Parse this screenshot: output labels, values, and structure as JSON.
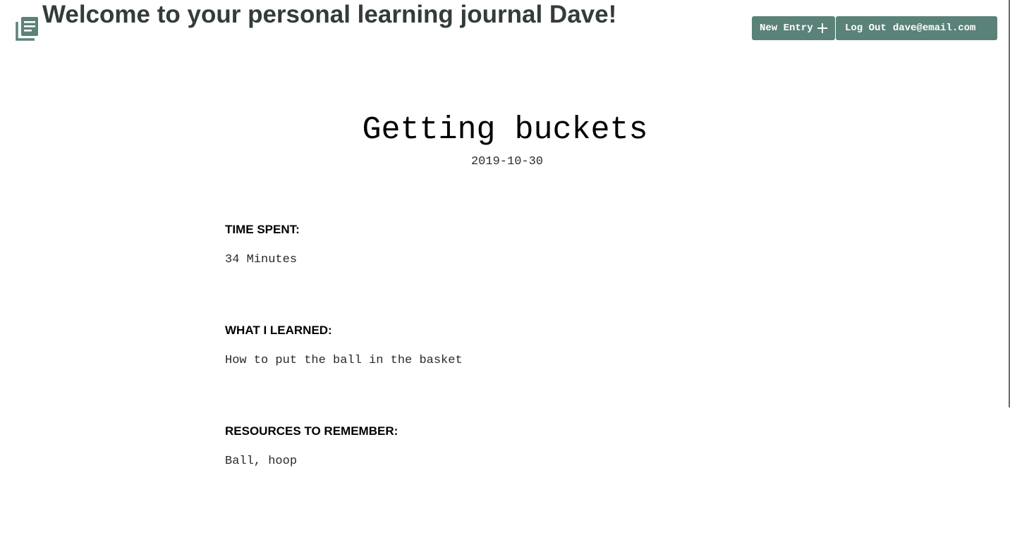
{
  "header": {
    "welcome": "Welcome to your personal learning journal Dave!",
    "icon": "journal-icon"
  },
  "nav": {
    "new_entry_label": "New Entry",
    "logout_label": "Log Out",
    "user_email": "dave@email.com"
  },
  "entry": {
    "title": "Getting buckets",
    "date": "2019-10-30",
    "sections": [
      {
        "label": "TIME SPENT:",
        "value": "34 Minutes"
      },
      {
        "label": "WHAT I LEARNED:",
        "value": "How to put the ball in the basket"
      },
      {
        "label": "RESOURCES TO REMEMBER:",
        "value": "Ball, hoop"
      }
    ]
  },
  "colors": {
    "accent": "#5b8279",
    "heading": "#343c3a"
  }
}
